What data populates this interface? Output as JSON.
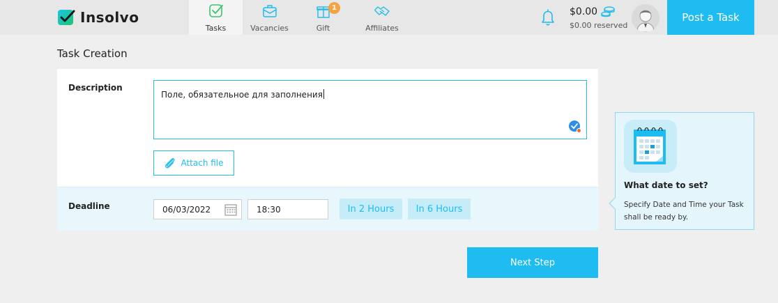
{
  "header": {
    "logo_text": "Insolvo",
    "nav": [
      {
        "label": "Tasks",
        "active": true
      },
      {
        "label": "Vacancies",
        "active": false
      },
      {
        "label": "Gift",
        "active": false,
        "badge": "1"
      },
      {
        "label": "Affiliates",
        "active": false
      }
    ],
    "balance": "$0.00",
    "reserved": "$0.00 reserved",
    "post_task_label": "Post a Task"
  },
  "page": {
    "title": "Task Creation"
  },
  "form": {
    "description": {
      "label": "Description",
      "value": "Поле, обязательное для заполнения",
      "attach_label": "Attach file"
    },
    "deadline": {
      "label": "Deadline",
      "date": "06/03/2022",
      "time": "18:30",
      "quick_options": [
        "In 2 Hours",
        "In 6 Hours"
      ]
    },
    "next_label": "Next Step"
  },
  "tip": {
    "title": "What date to set?",
    "text": "Specify Date and Time your Task shall be ready by."
  },
  "colors": {
    "accent": "#1ebcf0",
    "header_bg": "#e7e7e7",
    "page_bg": "#efefef",
    "badge": "#f5a243",
    "deadline_bg": "#e8f7fc"
  }
}
